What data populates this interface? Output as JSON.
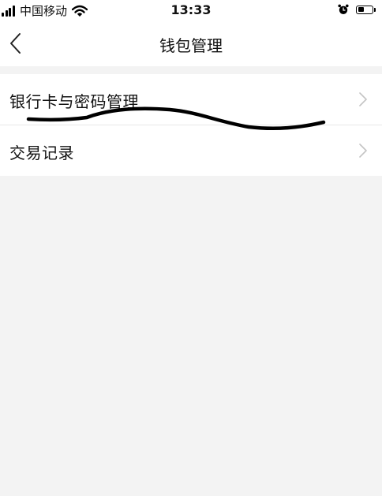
{
  "status_bar": {
    "carrier": "中国移动",
    "time": "13:33",
    "battery_level": 0.45
  },
  "nav": {
    "title": "钱包管理",
    "back_icon": "chevron-left-icon"
  },
  "menu": {
    "items": [
      {
        "label": "银行卡与密码管理",
        "icon": "chevron-right-icon"
      },
      {
        "label": "交易记录",
        "icon": "chevron-right-icon"
      }
    ]
  },
  "colors": {
    "page_background": "#f3f3f3",
    "surface": "#ffffff",
    "text": "#111111",
    "chevron": "#c4c4c4",
    "scribble": "#000000"
  }
}
